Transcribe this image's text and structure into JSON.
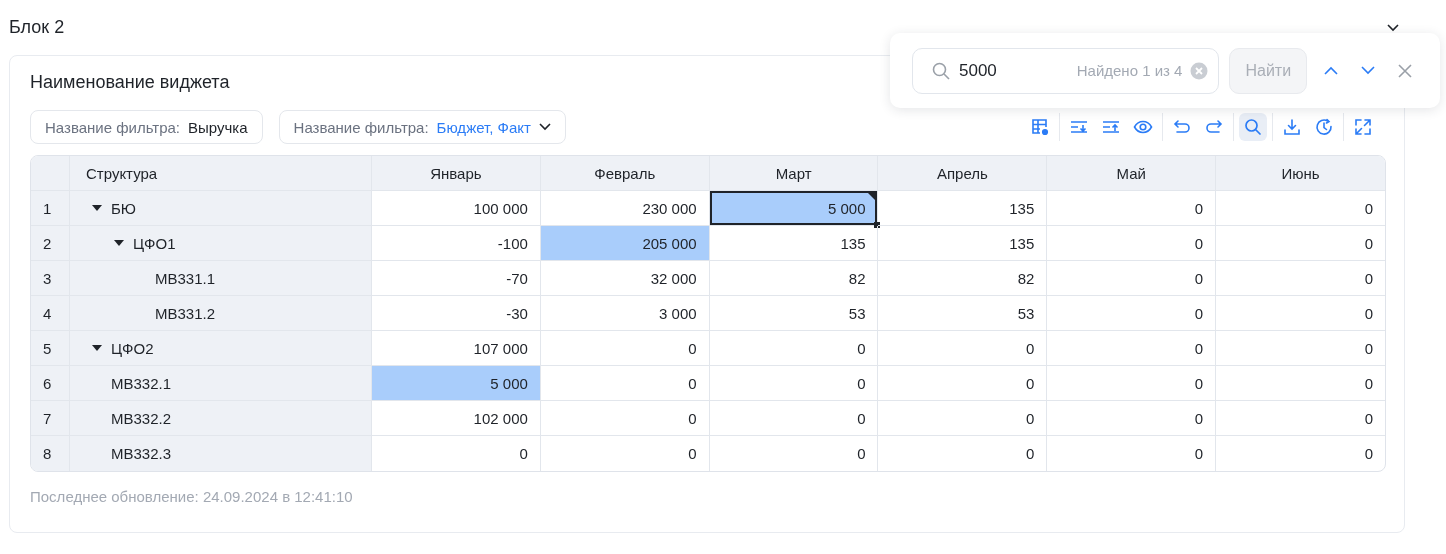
{
  "block": {
    "title": "Блок 2",
    "collapsed": false
  },
  "widget": {
    "title": "Наименование виджета",
    "filters": [
      {
        "label": "Название фильтра:",
        "value": "Выручка",
        "dropdown": false
      },
      {
        "label": "Название фильтра:",
        "value": "Бюджет, Факт",
        "dropdown": true
      }
    ],
    "toolbar_groups": [
      {
        "tools": [
          {
            "kind": "table-settings",
            "selected": false
          }
        ]
      },
      {
        "tools": [
          {
            "kind": "expand-rows",
            "selected": false
          },
          {
            "kind": "collapse-rows",
            "selected": false
          },
          {
            "kind": "visibility",
            "selected": false
          }
        ]
      },
      {
        "tools": [
          {
            "kind": "undo",
            "selected": false
          },
          {
            "kind": "redo",
            "selected": false
          }
        ]
      },
      {
        "tools": [
          {
            "kind": "search",
            "selected": true
          }
        ]
      },
      {
        "tools": [
          {
            "kind": "download",
            "selected": false
          },
          {
            "kind": "history",
            "selected": false
          }
        ]
      },
      {
        "tools": [
          {
            "kind": "fullscreen",
            "selected": false
          }
        ]
      }
    ],
    "table": {
      "tree_header": "Структура",
      "columns": [
        "Январь",
        "Февраль",
        "Март",
        "Апрель",
        "Май",
        "Июнь"
      ],
      "rows": [
        {
          "num": "1",
          "name": "БЮ",
          "kind": "group",
          "expanded": true,
          "cells": [
            {
              "value": "100 000",
              "found": false,
              "current": false
            },
            {
              "value": "230 000",
              "found": false,
              "current": false
            },
            {
              "value": "5 000",
              "found": true,
              "current": true
            },
            {
              "value": "135",
              "found": false,
              "current": false
            },
            {
              "value": "0",
              "found": false,
              "current": false
            },
            {
              "value": "0",
              "found": false,
              "current": false
            }
          ],
          "children": [
            {
              "num": "2",
              "name": "ЦФО1",
              "kind": "group",
              "expanded": true,
              "cells": [
                {
                  "value": "-100",
                  "found": false,
                  "current": false
                },
                {
                  "value": "205 000",
                  "found": true,
                  "current": false
                },
                {
                  "value": "135",
                  "found": false,
                  "current": false
                },
                {
                  "value": "135",
                  "found": false,
                  "current": false
                },
                {
                  "value": "0",
                  "found": false,
                  "current": false
                },
                {
                  "value": "0",
                  "found": false,
                  "current": false
                }
              ],
              "children": [
                {
                  "num": "3",
                  "name": "MB331.1",
                  "kind": "item",
                  "cells": [
                    {
                      "value": "-70",
                      "found": false,
                      "current": false
                    },
                    {
                      "value": "32 000",
                      "found": false,
                      "current": false
                    },
                    {
                      "value": "82",
                      "found": false,
                      "current": false
                    },
                    {
                      "value": "82",
                      "found": false,
                      "current": false
                    },
                    {
                      "value": "0",
                      "found": false,
                      "current": false
                    },
                    {
                      "value": "0",
                      "found": false,
                      "current": false
                    }
                  ]
                },
                {
                  "num": "4",
                  "name": "MB331.2",
                  "kind": "item",
                  "cells": [
                    {
                      "value": "-30",
                      "found": false,
                      "current": false
                    },
                    {
                      "value": "3 000",
                      "found": false,
                      "current": false
                    },
                    {
                      "value": "53",
                      "found": false,
                      "current": false
                    },
                    {
                      "value": "53",
                      "found": false,
                      "current": false
                    },
                    {
                      "value": "0",
                      "found": false,
                      "current": false
                    },
                    {
                      "value": "0",
                      "found": false,
                      "current": false
                    }
                  ]
                }
              ]
            }
          ]
        },
        {
          "num": "5",
          "name": "ЦФО2",
          "kind": "group",
          "expanded": true,
          "cells": [
            {
              "value": "107 000",
              "found": false,
              "current": false
            },
            {
              "value": "0",
              "found": false,
              "current": false
            },
            {
              "value": "0",
              "found": false,
              "current": false
            },
            {
              "value": "0",
              "found": false,
              "current": false
            },
            {
              "value": "0",
              "found": false,
              "current": false
            },
            {
              "value": "0",
              "found": false,
              "current": false
            }
          ]
        },
        {
          "num": "6",
          "name": "MB332.1",
          "kind": "item",
          "cells": [
            {
              "value": "5 000",
              "found": true,
              "current": false
            },
            {
              "value": "0",
              "found": false,
              "current": false
            },
            {
              "value": "0",
              "found": false,
              "current": false
            },
            {
              "value": "0",
              "found": false,
              "current": false
            },
            {
              "value": "0",
              "found": false,
              "current": false
            },
            {
              "value": "0",
              "found": false,
              "current": false
            }
          ]
        },
        {
          "num": "7",
          "name": "MB332.2",
          "kind": "item",
          "cells": [
            {
              "value": "102 000",
              "found": false,
              "current": false
            },
            {
              "value": "0",
              "found": false,
              "current": false
            },
            {
              "value": "0",
              "found": false,
              "current": false
            },
            {
              "value": "0",
              "found": false,
              "current": false
            },
            {
              "value": "0",
              "found": false,
              "current": false
            },
            {
              "value": "0",
              "found": false,
              "current": false
            }
          ]
        },
        {
          "num": "8",
          "name": "MB332.3",
          "kind": "item",
          "cells": [
            {
              "value": "0",
              "found": false,
              "current": false
            },
            {
              "value": "0",
              "found": false,
              "current": false
            },
            {
              "value": "0",
              "found": false,
              "current": false
            },
            {
              "value": "0",
              "found": false,
              "current": false
            },
            {
              "value": "0",
              "found": false,
              "current": false
            },
            {
              "value": "0",
              "found": false,
              "current": false
            }
          ]
        }
      ]
    },
    "last_update": "Последнее обновление: 24.09.2024 в 12:41:10"
  },
  "search_popup": {
    "value": "5000",
    "result": "Найдено 1 из 4",
    "button": {
      "label": "Найти",
      "disabled": true
    }
  }
}
